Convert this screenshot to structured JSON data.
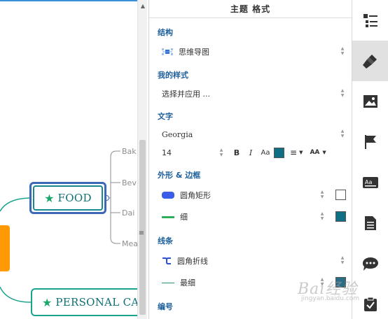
{
  "canvas": {
    "food_node": {
      "label": "FOOD"
    },
    "personal_node": {
      "label": "PERSONAL CA"
    },
    "sub_topics": [
      "Bak",
      "Bev",
      "Dai",
      "Mea"
    ]
  },
  "panel": {
    "title": "主题 格式",
    "structure": {
      "title": "结构",
      "value": "思维导图"
    },
    "my_style": {
      "title": "我的样式",
      "value": "选择并应用 ..."
    },
    "text": {
      "title": "文字",
      "font": "Georgia",
      "size": "14",
      "bold": "B",
      "italic": "I",
      "case": "Aa",
      "text_color": "#0f6f84",
      "align": "≡",
      "caps": "AA"
    },
    "shape_border": {
      "title": "外形 & 边框",
      "shape": "圆角矩形",
      "shape_fill": "#ffffff",
      "border": "细",
      "border_color": "#0f6f84"
    },
    "line": {
      "title": "线条",
      "style": "圆角折线",
      "width": "最细"
    },
    "numbering": {
      "title": "编号"
    }
  },
  "sidebar": {
    "items": [
      "outline-icon",
      "format-icon",
      "image-icon",
      "flag-icon",
      "label-icon",
      "notes-icon",
      "comment-icon",
      "task-icon"
    ]
  },
  "colors": {
    "accent": "#1c5f9a",
    "node_border": "#3d68b5",
    "topic": "#17888c",
    "central": "#ff9a06"
  },
  "watermark": {
    "brand": "Bai经验",
    "url": "jingyan.baidu.com"
  }
}
